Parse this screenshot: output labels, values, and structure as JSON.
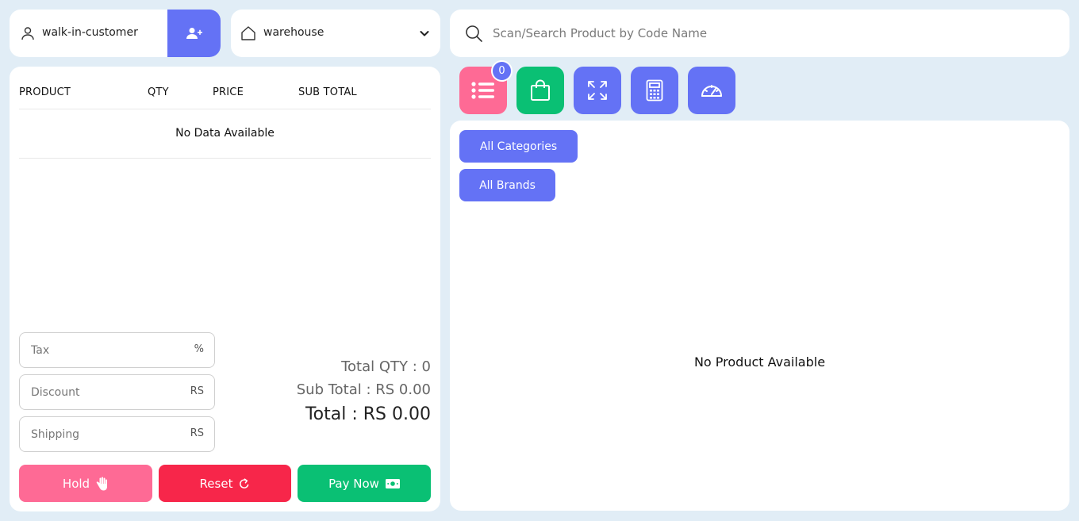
{
  "customer": {
    "value": "walk-in-customer",
    "add_icon": "user-plus-icon"
  },
  "warehouse": {
    "value": "warehouse"
  },
  "search": {
    "placeholder": "Scan/Search Product by Code Name"
  },
  "cart": {
    "columns": [
      "PRODUCT",
      "QTY",
      "PRICE",
      "SUB TOTAL"
    ],
    "empty_text": "No Data Available",
    "tax": {
      "placeholder": "Tax",
      "suffix": "%"
    },
    "discount": {
      "placeholder": "Discount",
      "suffix": "RS"
    },
    "shipping": {
      "placeholder": "Shipping",
      "suffix": "RS"
    },
    "total_qty": "Total QTY : 0",
    "sub_total": "Sub Total : RS 0.00",
    "grand_total": "Total : RS 0.00",
    "actions": {
      "hold": "Hold",
      "reset": "Reset",
      "pay_now": "Pay Now"
    }
  },
  "tools": {
    "list_badge": "0",
    "icons": [
      "list-icon",
      "shopping-bag-icon",
      "fullscreen-icon",
      "calculator-icon",
      "dashboard-icon"
    ]
  },
  "products": {
    "all_categories": "All Categories",
    "all_brands": "All Brands",
    "empty_text": "No Product Available"
  },
  "colors": {
    "background": "#e1edf6",
    "primary": "#6472f5",
    "pink": "#fe6a95",
    "red": "#f7264a",
    "green": "#0ac074"
  }
}
